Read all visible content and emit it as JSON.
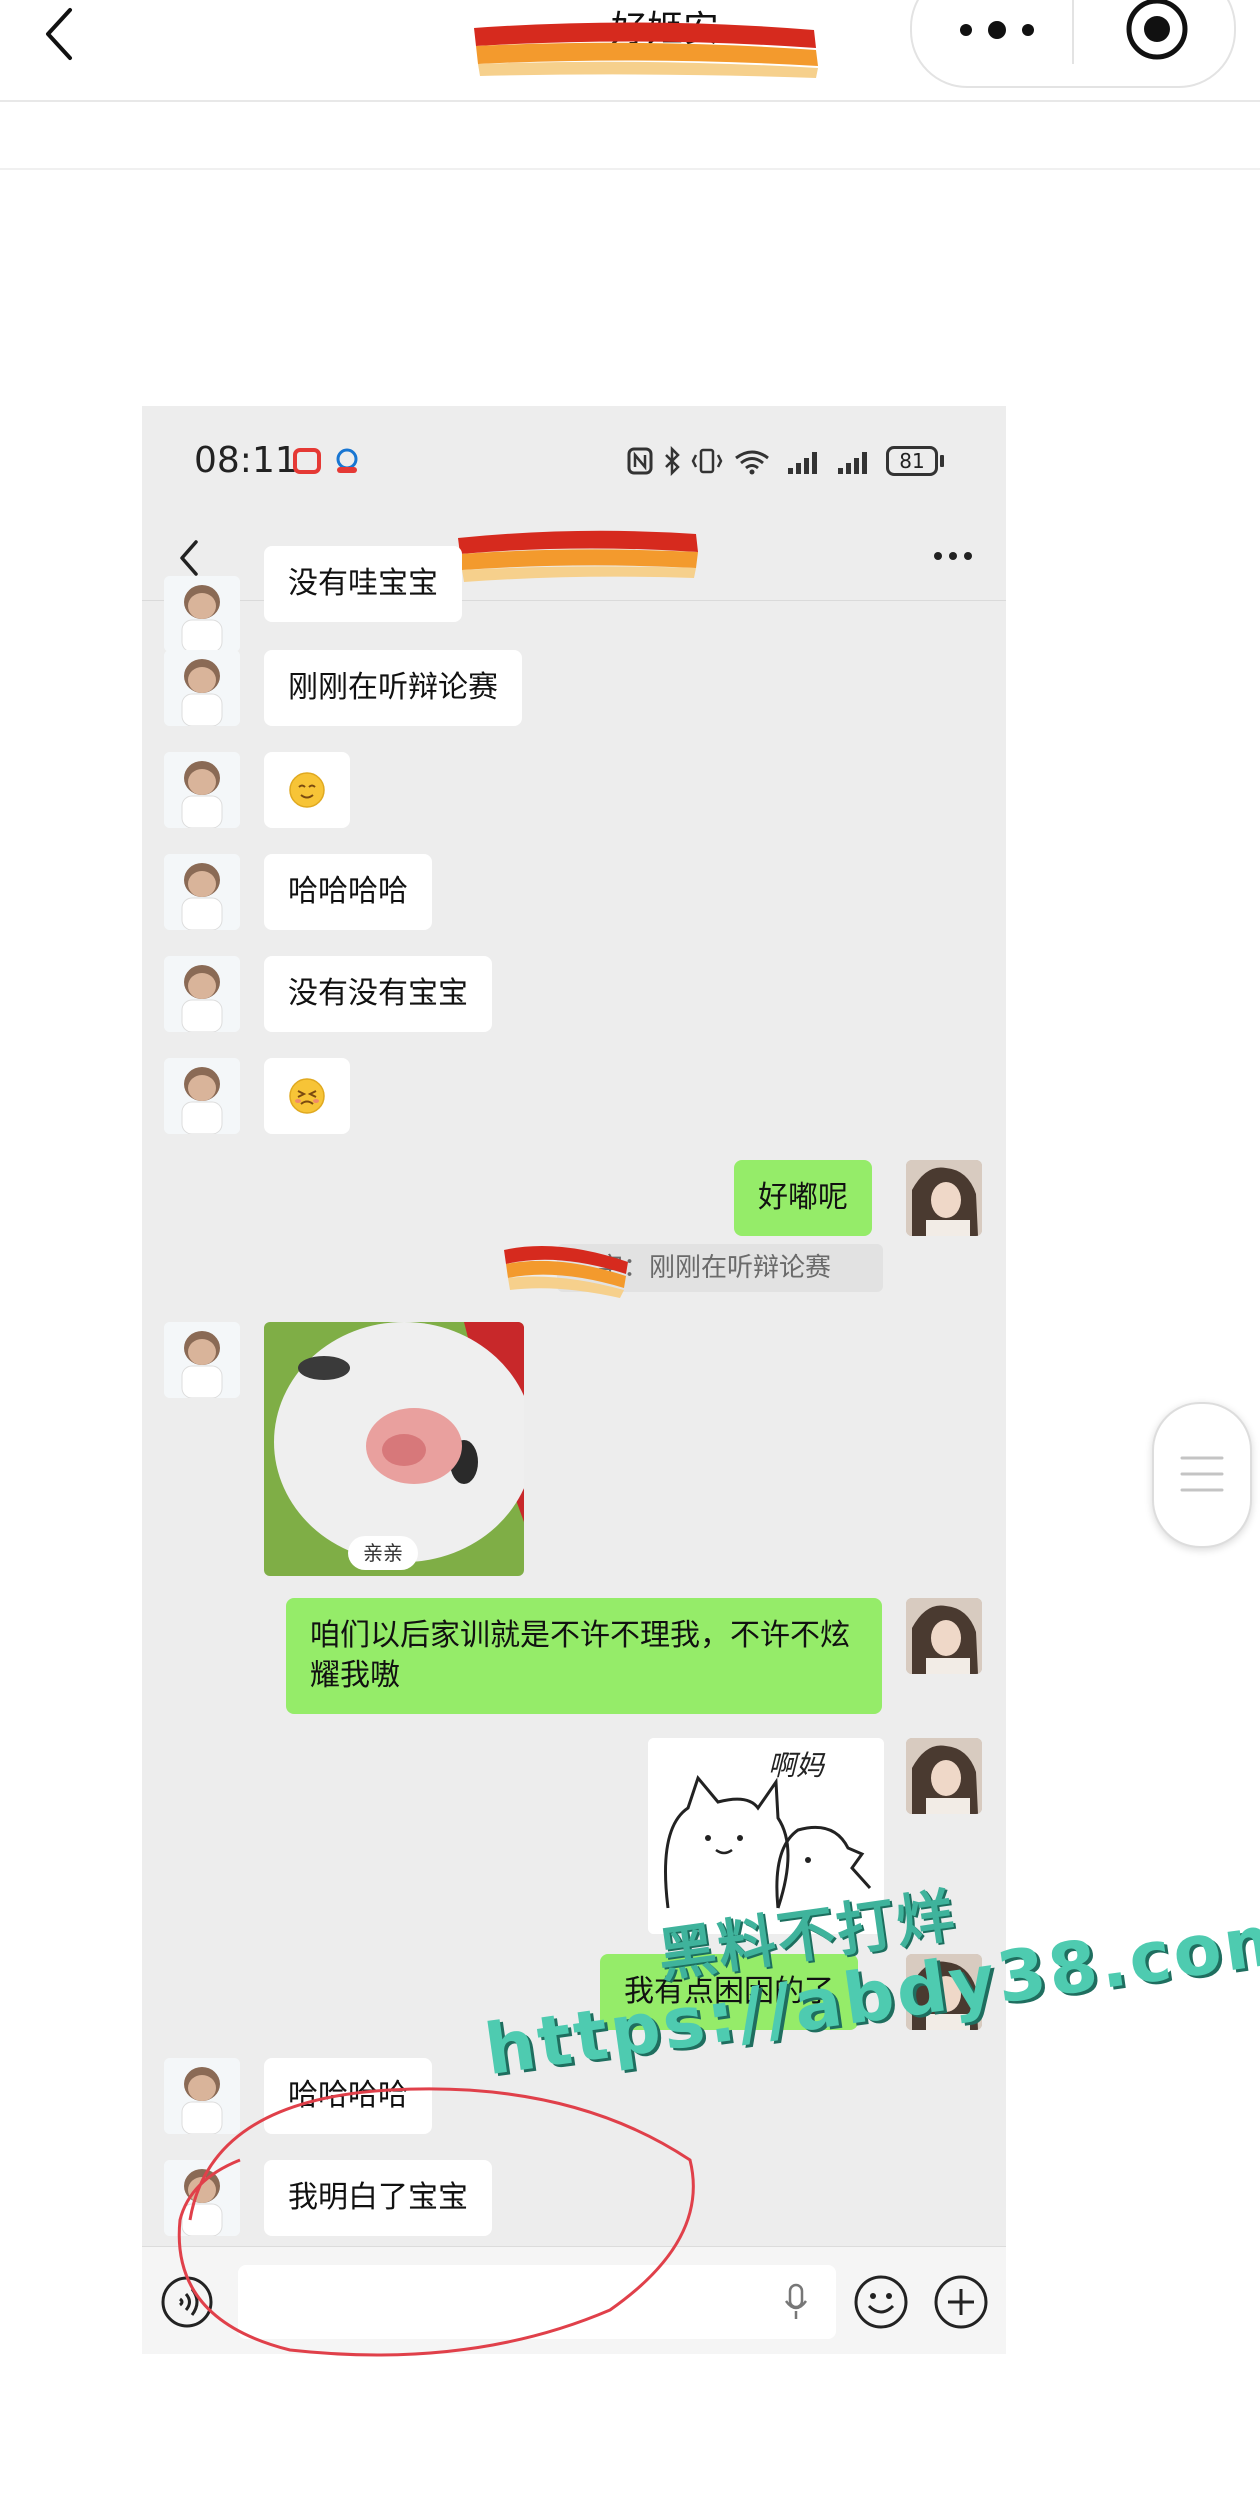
{
  "outer": {
    "title": "好姬安"
  },
  "status_bar": {
    "time": "08:11",
    "battery": "81"
  },
  "messages": [
    {
      "side": "left",
      "text": "没有哇宝宝"
    },
    {
      "side": "left",
      "text": "刚刚在听辩论赛"
    },
    {
      "side": "left",
      "emoji": "☺"
    },
    {
      "side": "left",
      "text": "哈哈哈哈"
    },
    {
      "side": "left",
      "text": "没有没有宝宝"
    },
    {
      "side": "left",
      "emoji": "😣"
    },
    {
      "side": "right",
      "text": "好嘟呢"
    },
    {
      "quote": "字：刚刚在听辩论赛"
    },
    {
      "side": "left",
      "sticker": "cat",
      "sticker_label": "亲亲"
    },
    {
      "side": "right",
      "text": "咱们以后家训就是不许不理我，不许不炫耀我嗷"
    },
    {
      "side": "right",
      "sticker": "doodle",
      "sticker_text": "啊妈"
    },
    {
      "side": "right",
      "text": "我有点困困的了"
    },
    {
      "side": "left",
      "text": "哈哈哈哈"
    },
    {
      "side": "left",
      "text": "我明白了宝宝"
    }
  ],
  "watermark": {
    "line1": "黑料不打烊",
    "line2": "https://abdy38.com"
  },
  "icons": {
    "outer_back": "chevron-left-icon",
    "outer_more": "more-dots-icon",
    "outer_close": "target-icon",
    "chat_back": "chevron-left-icon",
    "chat_more": "more-dots-icon",
    "voice": "voice-icon",
    "mic": "mic-icon",
    "emoji": "emoji-icon",
    "plus": "plus-icon"
  }
}
